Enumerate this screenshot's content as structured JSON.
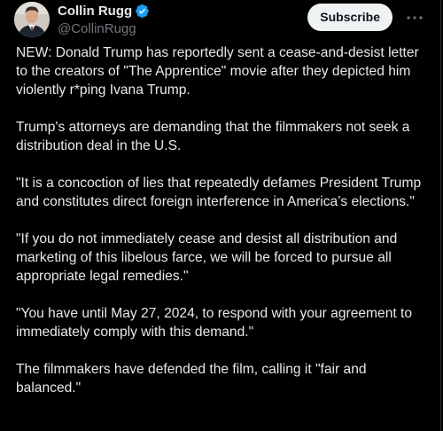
{
  "post": {
    "author": {
      "display_name": "Collin Rugg",
      "handle": "@CollinRugg",
      "verified_badge_color": "#1d9bf0"
    },
    "subscribe_label": "Subscribe",
    "more_icon": "more-horizontal-icon",
    "paragraphs": [
      "NEW: Donald Trump has reportedly sent a cease-and-desist letter to the creators of \"The Apprentice\" movie after they depicted him violently r*ping Ivana Trump.",
      "Trump's attorneys are demanding that the filmmakers not seek a distribution deal in the U.S.",
      "\"It is a concoction of lies that repeatedly defames President Trump and constitutes direct foreign interference in America’s elections.\"",
      "\"If you do not immediately cease and desist all distribution and marketing of this libelous farce, we will be forced to pursue all appropriate legal remedies.\"",
      "\"You have until May 27, 2024, to respond with your agreement to immediately comply with this demand.\"",
      "The filmmakers have defended the film, calling it \"fair and balanced.\""
    ]
  }
}
